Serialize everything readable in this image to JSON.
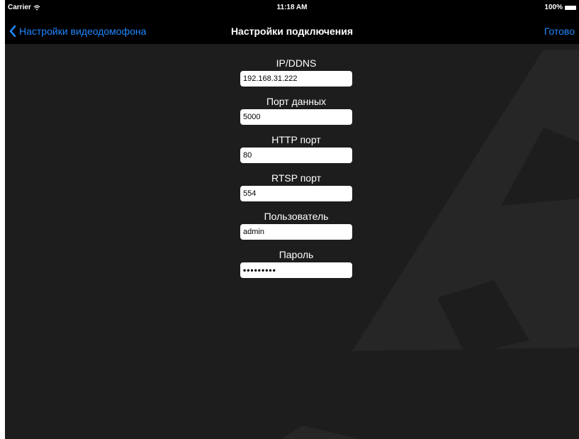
{
  "status": {
    "carrier": "Carrier",
    "time": "11:18 AM",
    "battery": "100%"
  },
  "nav": {
    "back_label": "Настройки видеодомофона",
    "title": "Настройки подключения",
    "done_label": "Готово"
  },
  "form": {
    "fields": [
      {
        "label": "IP/DDNS",
        "value": "192.168.31.222"
      },
      {
        "label": "Порт данных",
        "value": "5000"
      },
      {
        "label": "HTTP порт",
        "value": "80"
      },
      {
        "label": "RTSP порт",
        "value": "554"
      },
      {
        "label": "Пользователь",
        "value": "admin"
      },
      {
        "label": "Пароль",
        "value": "•••••••••"
      }
    ]
  },
  "colors": {
    "accent": "#1e88ff",
    "background": "#1d1d1d",
    "bar": "#000000"
  }
}
